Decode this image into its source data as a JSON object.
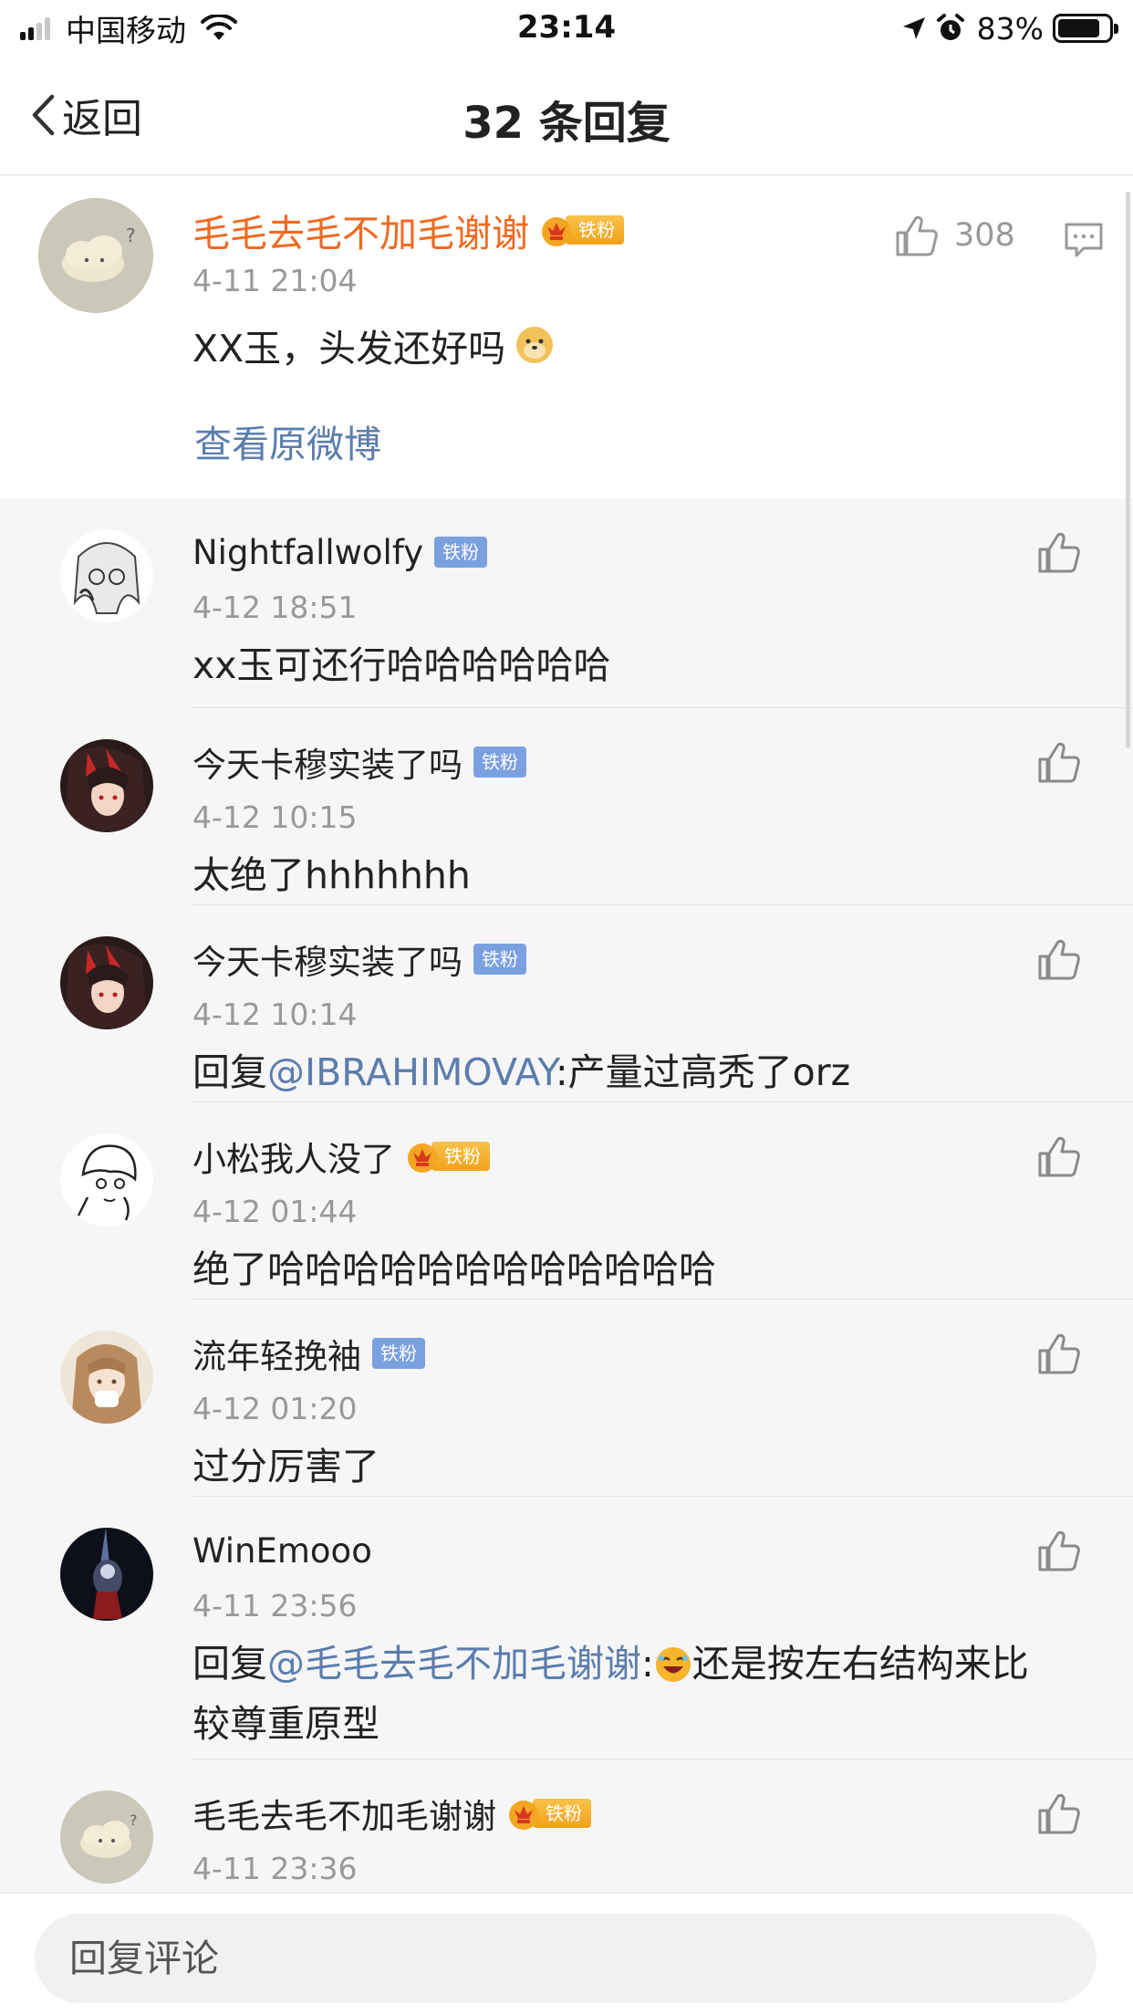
{
  "status_bar": {
    "carrier": "中国移动",
    "time": "23:14",
    "battery": "83%",
    "battery_level": 0.83,
    "icons": [
      "signal-icon",
      "wifi-icon",
      "location-arrow-icon",
      "alarm-icon",
      "battery-icon"
    ]
  },
  "nav": {
    "back_label": "返回",
    "title": "32 条回复"
  },
  "main_comment": {
    "author": "毛毛去毛不加毛谢谢",
    "badge": "铁粉",
    "time": "4-11 21:04",
    "text": "XX玉，头发还好吗",
    "emoji": "doge-emoji",
    "like_count": "308",
    "view_original": "查看原微博"
  },
  "replies": [
    {
      "author": "Nightfallwolfy",
      "author_style": "normal",
      "badge": "铁粉",
      "badge_type": "blue",
      "time": "4-12 18:51",
      "text": "xx玉可还行哈哈哈哈哈哈"
    },
    {
      "author": "今天卡穆实装了吗",
      "author_style": "normal",
      "badge": "铁粉",
      "badge_type": "blue",
      "time": "4-12 10:15",
      "text": "太绝了hhhhhhh"
    },
    {
      "author": "今天卡穆实装了吗",
      "author_style": "normal",
      "badge": "铁粉",
      "badge_type": "blue",
      "time": "4-12 10:14",
      "prefix": "回复",
      "mention": "@IBRAHIMOVAY",
      "text": ":产量过高秃了orz"
    },
    {
      "author": "小松我人没了",
      "author_style": "orange",
      "badge": "铁粉",
      "badge_type": "gold",
      "time": "4-12 01:44",
      "text": "绝了哈哈哈哈哈哈哈哈哈哈哈哈"
    },
    {
      "author": "流年轻挽袖",
      "author_style": "normal",
      "badge": "铁粉",
      "badge_type": "blue",
      "time": "4-12 01:20",
      "text": "过分厉害了"
    },
    {
      "author": "WinEmooo",
      "author_style": "normal",
      "badge": "",
      "badge_type": "none",
      "time": "4-11 23:56",
      "prefix": "回复",
      "mention": "@毛毛去毛不加毛谢谢",
      "emoji": "laughing-emoji",
      "text_before_emoji": ":",
      "text": "还是按左右结构来比较尊重原型"
    },
    {
      "author": "毛毛去毛不加毛谢谢",
      "author_style": "orange",
      "badge": "铁粉",
      "badge_type": "gold",
      "time": "4-11 23:36",
      "text": ""
    }
  ],
  "bottom_bar": {
    "input_placeholder": "回复评论"
  },
  "colors": {
    "accent_orange": "#f06a22",
    "link_blue": "#5b7dad",
    "badge_blue": "#7aa0e0",
    "badge_gold": "#f2a11a",
    "background": "#f6f6f6"
  }
}
